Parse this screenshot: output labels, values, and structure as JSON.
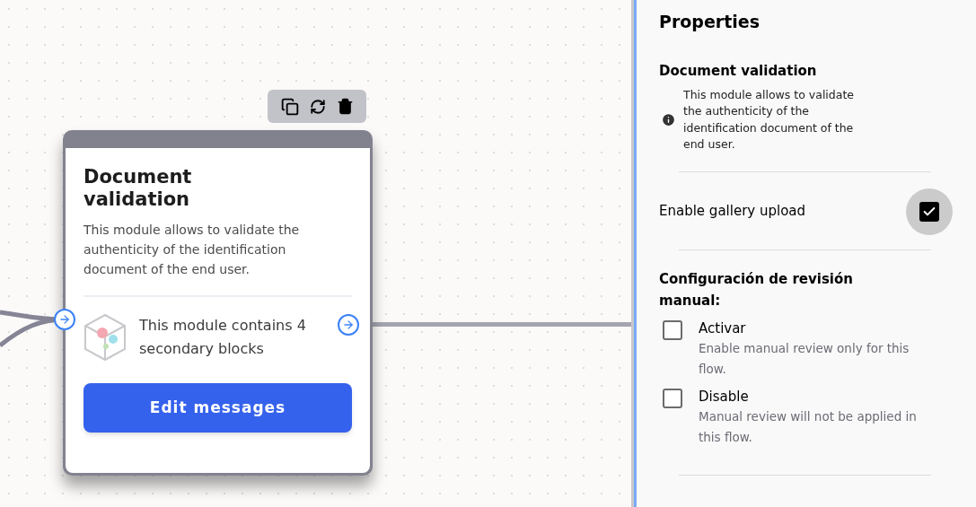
{
  "card": {
    "title": "Document validation",
    "description": "This module allows to validate the authenticity of the identification document of the end user.",
    "blocks_text": "This module contains 4 secondary blocks",
    "button": "Edit messages"
  },
  "properties": {
    "title": "Properties",
    "section_title": "Document validation",
    "info": "This module allows to validate the authenticity of the identification document of the end user.",
    "gallery_upload": {
      "label": "Enable gallery upload",
      "checked": true
    },
    "manual_review": {
      "title": "Configuración de revisión manual:",
      "options": [
        {
          "label": "Activar",
          "description": "Enable manual review only for this flow.",
          "checked": false
        },
        {
          "label": "Disable",
          "description": "Manual review will not be applied in this flow.",
          "checked": false
        }
      ]
    }
  }
}
